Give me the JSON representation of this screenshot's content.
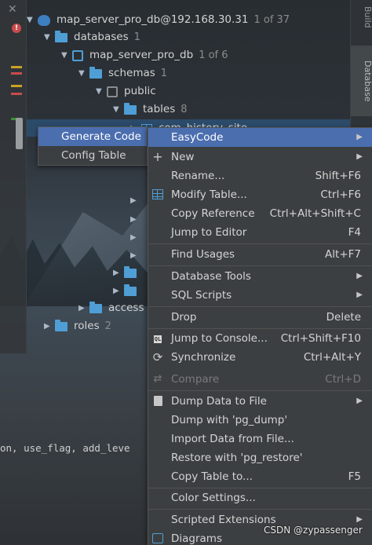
{
  "sidebar_right": {
    "build_tab": "Build",
    "database_tab": "Database"
  },
  "tree": {
    "connection": {
      "label": "map_server_pro_db@192.168.30.31",
      "count": "1 of 37"
    },
    "databases": {
      "label": "databases",
      "count": "1"
    },
    "db": {
      "label": "map_server_pro_db",
      "count": "1 of 6"
    },
    "schemas": {
      "label": "schemas",
      "count": "1"
    },
    "public": {
      "label": "public"
    },
    "tables": {
      "label": "tables",
      "count": "8"
    },
    "selected_table": {
      "label": "com_history_site"
    },
    "access": {
      "label": "access"
    },
    "roles": {
      "label": "roles",
      "count": "2"
    }
  },
  "editor": {
    "code_fragment": "on, use_flag, add_leve"
  },
  "submenu": {
    "items": [
      {
        "label": "Generate Code"
      },
      {
        "label": "Config Table"
      }
    ]
  },
  "context_menu": {
    "items": [
      {
        "label": "EasyCode",
        "icon": "",
        "shortcut": "",
        "submenu": true
      },
      {
        "label": "New",
        "icon": "plus-icon",
        "shortcut": "",
        "submenu": true
      },
      {
        "label": "Rename...",
        "icon": "",
        "shortcut": "Shift+F6"
      },
      {
        "label": "Modify Table...",
        "icon": "table-icon",
        "shortcut": "Ctrl+F6"
      },
      {
        "label": "Copy Reference",
        "icon": "",
        "shortcut": "Ctrl+Alt+Shift+C"
      },
      {
        "label": "Jump to Editor",
        "icon": "",
        "shortcut": "F4"
      },
      {
        "label": "Find Usages",
        "icon": "",
        "shortcut": "Alt+F7"
      },
      {
        "label": "Database Tools",
        "icon": "",
        "shortcut": "",
        "submenu": true
      },
      {
        "label": "SQL Scripts",
        "icon": "",
        "shortcut": "",
        "submenu": true
      },
      {
        "label": "Drop",
        "icon": "",
        "shortcut": "Delete"
      },
      {
        "label": "Jump to Console...",
        "icon": "console-icon",
        "shortcut": "Ctrl+Shift+F10"
      },
      {
        "label": "Synchronize",
        "icon": "sync-icon",
        "shortcut": "Ctrl+Alt+Y"
      },
      {
        "label": "Compare",
        "icon": "compare-icon",
        "shortcut": "Ctrl+D",
        "disabled": true
      },
      {
        "label": "Dump Data to File",
        "icon": "dump-icon",
        "shortcut": "",
        "submenu": true
      },
      {
        "label": "Dump with 'pg_dump'",
        "icon": "",
        "shortcut": ""
      },
      {
        "label": "Import Data from File...",
        "icon": "",
        "shortcut": ""
      },
      {
        "label": "Restore with 'pg_restore'",
        "icon": "",
        "shortcut": ""
      },
      {
        "label": "Copy Table to...",
        "icon": "",
        "shortcut": "F5"
      },
      {
        "label": "Color Settings...",
        "icon": "",
        "shortcut": ""
      },
      {
        "label": "Scripted Extensions",
        "icon": "",
        "shortcut": "",
        "submenu": true
      },
      {
        "label": "Diagrams",
        "icon": "diagram-icon",
        "shortcut": "",
        "submenu": true
      }
    ]
  },
  "watermark": "CSDN @zypassenger",
  "colors": {
    "menu_bg": "#3c3f41",
    "highlight": "#4b6eaf",
    "folder": "#4f9ed6"
  }
}
